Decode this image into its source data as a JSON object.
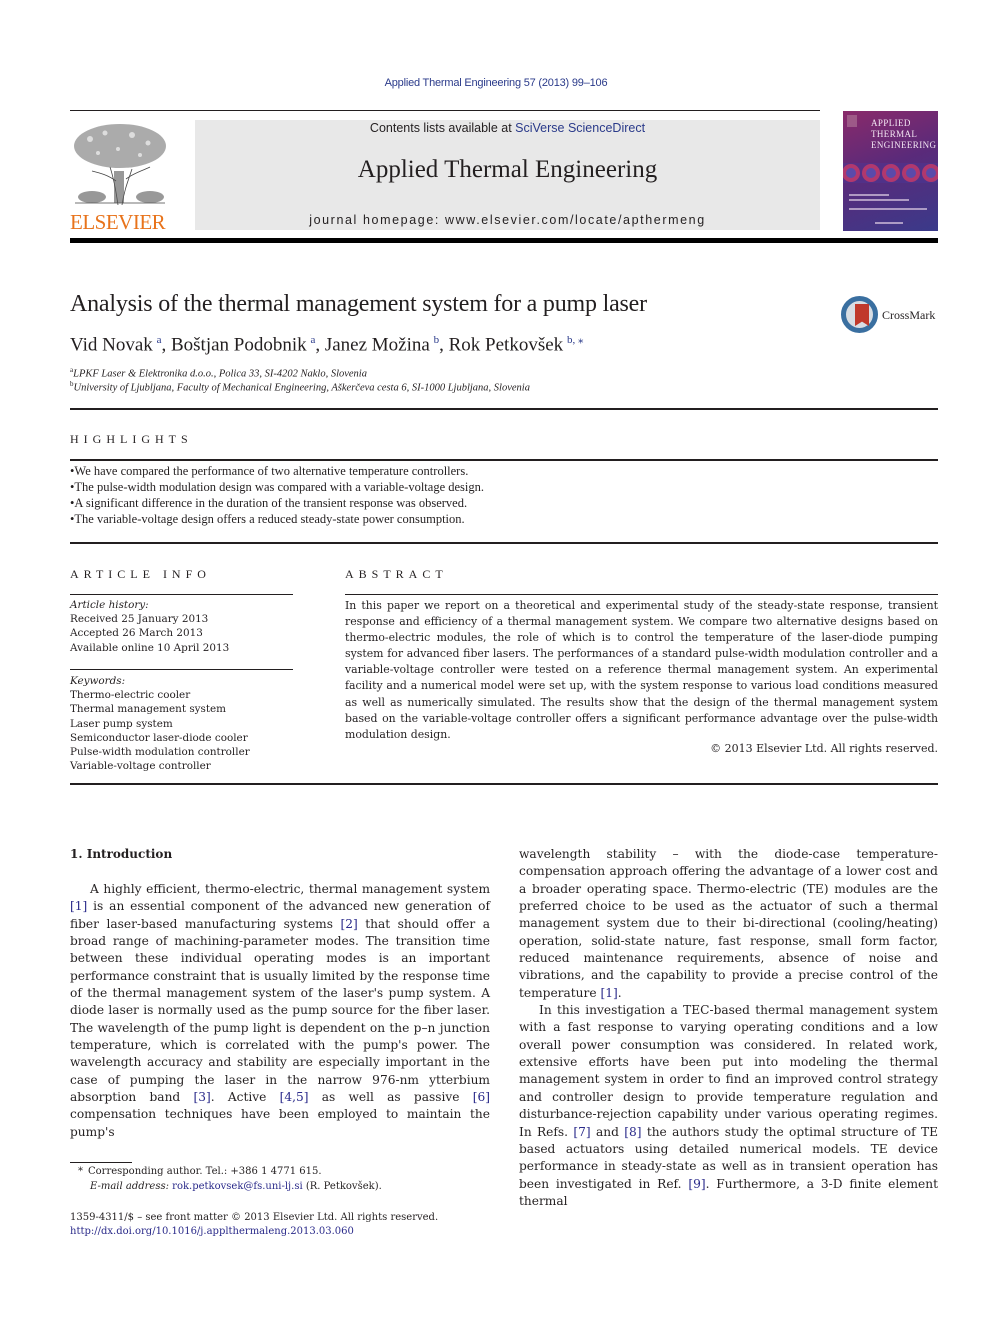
{
  "running_header": "Applied Thermal Engineering 57 (2013) 99–106",
  "masthead": {
    "contents_prefix": "Contents lists available at ",
    "contents_link": "SciVerse ScienceDirect",
    "journal_title": "Applied Thermal Engineering",
    "homepage": "journal homepage: www.elsevier.com/locate/apthermeng",
    "publisher_logo_text": "ELSEVIER",
    "cover_title_lines": [
      "APPLIED",
      "THERMAL",
      "ENGINEERING"
    ]
  },
  "article": {
    "title": "Analysis of the thermal management system for a pump laser",
    "crossmark_label": "CrossMark",
    "authors": [
      {
        "name": "Vid Novak",
        "aff": "a"
      },
      {
        "name": "Boštjan Podobnik",
        "aff": "a"
      },
      {
        "name": "Janez Možina",
        "aff": "b"
      },
      {
        "name": "Rok Petkovšek",
        "aff": "b, ⁎"
      }
    ],
    "affiliations": [
      {
        "key": "a",
        "text": "LPKF Laser & Elektronika d.o.o., Polica 33, SI-4202 Naklo, Slovenia"
      },
      {
        "key": "b",
        "text": "University of Ljubljana, Faculty of Mechanical Engineering, Aškerčeva cesta 6, SI-1000 Ljubljana, Slovenia"
      }
    ]
  },
  "highlights": {
    "label": "HIGHLIGHTS",
    "items": [
      "We have compared the performance of two alternative temperature controllers.",
      "The pulse-width modulation design was compared with a variable-voltage design.",
      "A significant difference in the duration of the transient response was observed.",
      "The variable-voltage design offers a reduced steady-state power consumption."
    ]
  },
  "article_info": {
    "label": "ARTICLE INFO",
    "history_label": "Article history:",
    "history": [
      "Received 25 January 2013",
      "Accepted 26 March 2013",
      "Available online 10 April 2013"
    ],
    "keywords_label": "Keywords:",
    "keywords": [
      "Thermo-electric cooler",
      "Thermal management system",
      "Laser pump system",
      "Semiconductor laser-diode cooler",
      "Pulse-width modulation controller",
      "Variable-voltage controller"
    ]
  },
  "abstract": {
    "label": "ABSTRACT",
    "text": "In this paper we report on a theoretical and experimental study of the steady-state response, transient response and efficiency of a thermal management system. We compare two alternative designs based on thermo-electric modules, the role of which is to control the temperature of the laser-diode pumping system for advanced fiber lasers. The performances of a standard pulse-width modulation controller and a variable-voltage controller were tested on a reference thermal management system. An experimental facility and a numerical model were set up, with the system response to various load conditions measured as well as numerically simulated. The results show that the design of the thermal management system based on the variable-voltage controller offers a significant performance advantage over the pulse-width modulation design.",
    "copyright": "© 2013 Elsevier Ltd. All rights reserved."
  },
  "body": {
    "section_heading": "1.  Introduction",
    "left_col": {
      "p1_a": "A highly efficient, thermo-electric, thermal management system ",
      "ref1": "[1]",
      "p1_b": " is an essential component of the advanced new generation of fiber laser-based manufacturing systems ",
      "ref2": "[2]",
      "p1_c": " that should offer a broad range of machining-parameter modes. The transition time between these individual operating modes is an important performance constraint that is usually limited by the response time of the thermal management system of the laser's pump system. A diode laser is normally used as the pump source for the fiber laser. The wavelength of the pump light is dependent on the p–n junction temperature, which is correlated with the pump's power. The wavelength accuracy and stability are especially important in the case of pumping the laser in the narrow 976-nm ytterbium absorption band ",
      "ref3": "[3]",
      "p1_d": ". Active ",
      "ref45": "[4,5]",
      "p1_e": " as well as passive ",
      "ref6": "[6]",
      "p1_f": " compensation techniques have been employed to maintain the pump's"
    },
    "right_col": {
      "p1_a": "wavelength stability – with the diode-case temperature-compensation approach offering the advantage of a lower cost and a broader operating space. Thermo-electric (TE) modules are the preferred choice to be used as the actuator of such a thermal management system due to their bi-directional (cooling/heating) operation, solid-state nature, fast response, small form factor, reduced maintenance requirements, absence of noise and vibrations, and the capability to provide a precise control of the temperature ",
      "ref1": "[1]",
      "p1_b": ".",
      "p2_a": "In this investigation a TEC-based thermal management system with a fast response to varying operating conditions and a low overall power consumption was considered. In related work, extensive efforts have been put into modeling the thermal management system in order to find an improved control strategy and controller design to provide temperature regulation and disturbance-rejection capability under various operating regimes. In Refs. ",
      "ref7": "[7]",
      "p2_b": " and ",
      "ref8": "[8]",
      "p2_c": " the authors study the optimal structure of TE based actuators using detailed numerical models. TE device performance in steady-state as well as in transient operation has been investigated in Ref. ",
      "ref9": "[9]",
      "p2_d": ". Furthermore, a 3-D finite element thermal"
    }
  },
  "footnotes": {
    "corresponding": "Corresponding author. Tel.: +386 1 4771 615.",
    "email_label": "E-mail address:",
    "email": "rok.petkovsek@fs.uni-lj.si",
    "email_suffix": " (R. Petkovšek).",
    "issn_line": "1359-4311/$ – see front matter © 2013 Elsevier Ltd. All rights reserved.",
    "doi": "http://dx.doi.org/10.1016/j.applthermaleng.2013.03.060"
  }
}
